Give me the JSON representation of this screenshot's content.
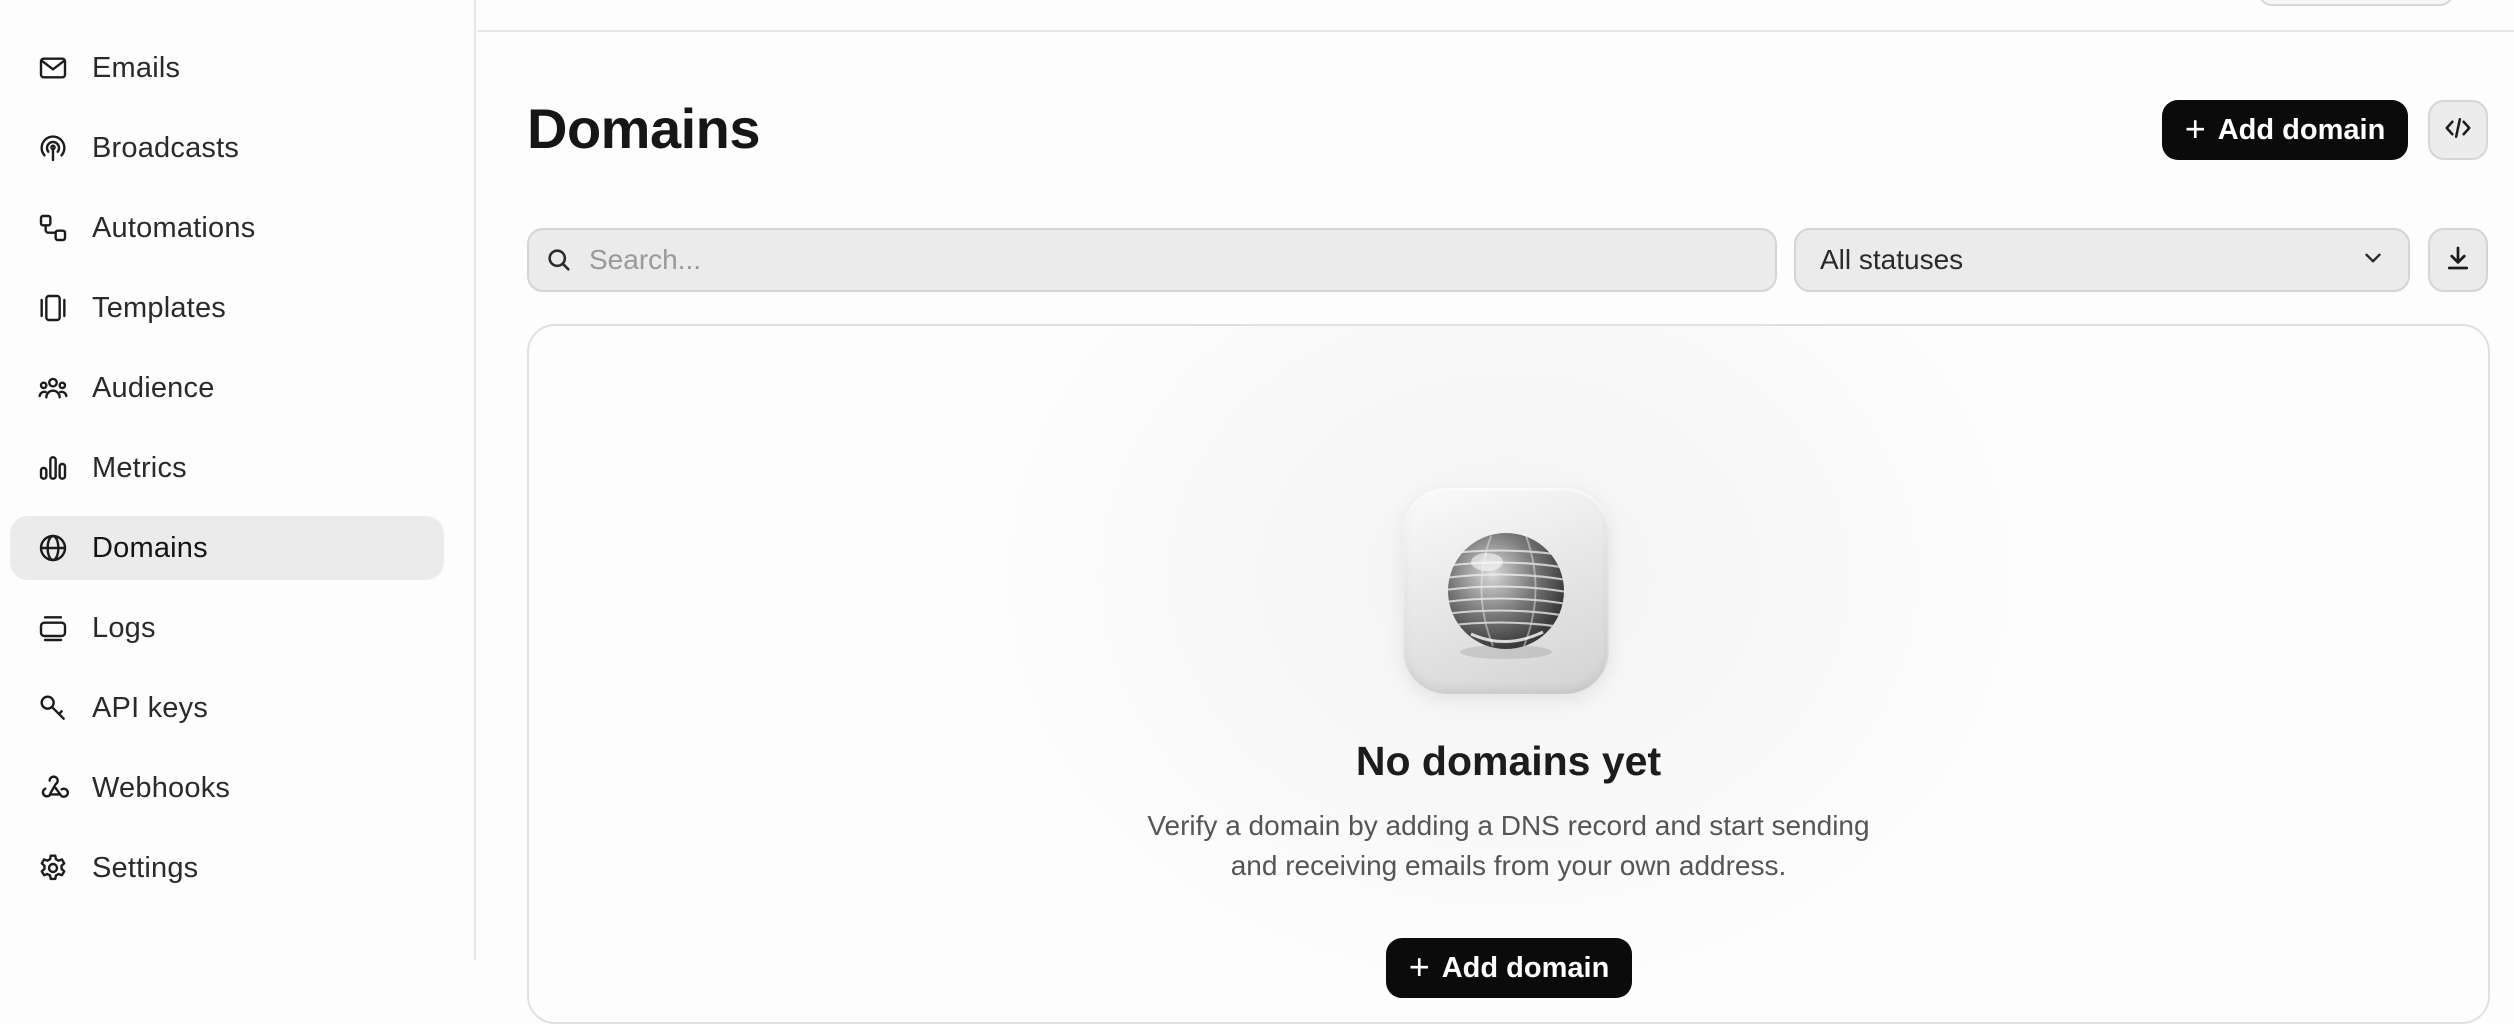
{
  "sidebar": {
    "items": [
      {
        "label": "Emails",
        "icon": "mail-icon"
      },
      {
        "label": "Broadcasts",
        "icon": "broadcast-icon"
      },
      {
        "label": "Automations",
        "icon": "automation-icon"
      },
      {
        "label": "Templates",
        "icon": "templates-icon"
      },
      {
        "label": "Audience",
        "icon": "audience-icon"
      },
      {
        "label": "Metrics",
        "icon": "metrics-icon"
      },
      {
        "label": "Domains",
        "icon": "globe-icon",
        "active": true
      },
      {
        "label": "Logs",
        "icon": "logs-icon"
      },
      {
        "label": "API keys",
        "icon": "key-icon"
      },
      {
        "label": "Webhooks",
        "icon": "webhook-icon"
      },
      {
        "label": "Settings",
        "icon": "gear-icon"
      }
    ]
  },
  "header": {
    "title": "Domains",
    "add_button": "Add domain",
    "plus_glyph": "+"
  },
  "filters": {
    "search_placeholder": "Search...",
    "status_value": "All statuses"
  },
  "empty_state": {
    "title": "No domains yet",
    "description": "Verify a domain by adding a DNS record and start sending and receiving emails from your own address.",
    "button": "Add domain",
    "plus_glyph": "+"
  },
  "colors": {
    "accent": "#0b0b0b",
    "active_nav_bg": "#ebebeb"
  }
}
